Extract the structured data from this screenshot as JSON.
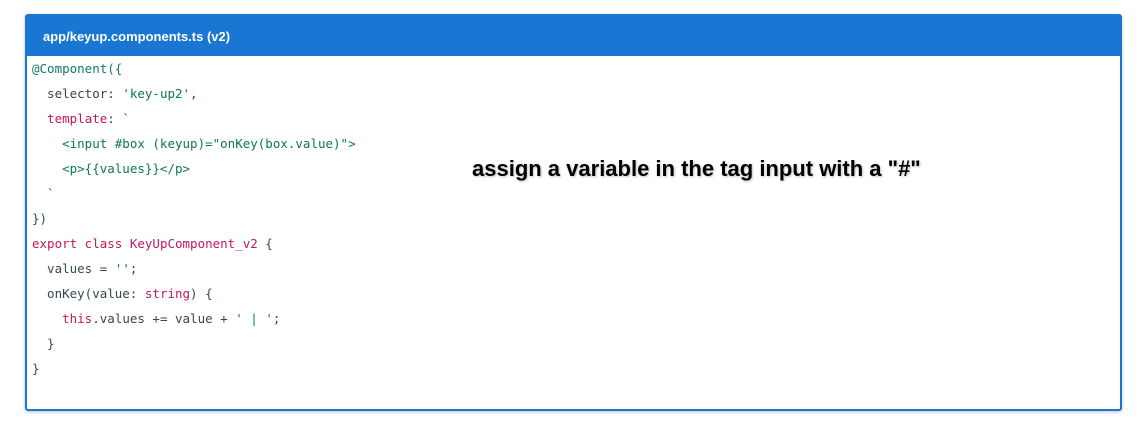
{
  "panel": {
    "title": "app/keyup.components.ts (v2)"
  },
  "code": {
    "lines": [
      [
        {
          "t": "@Component({",
          "c": "dec"
        }
      ],
      [
        {
          "t": "  selector: ",
          "c": "prop"
        },
        {
          "t": "'key-up2'",
          "c": "str"
        },
        {
          "t": ",",
          "c": "punc"
        }
      ],
      [
        {
          "t": "  ",
          "c": "punc"
        },
        {
          "t": "template",
          "c": "key"
        },
        {
          "t": ": `",
          "c": "punc"
        }
      ],
      [
        {
          "t": "    <input #box (keyup)=\"onKey(box.value)\">",
          "c": "tmpl"
        }
      ],
      [
        {
          "t": "    <p>{{values}}</p>",
          "c": "tmpl"
        }
      ],
      [
        {
          "t": "  `",
          "c": "punc"
        }
      ],
      [
        {
          "t": "})",
          "c": "punc"
        }
      ],
      [
        {
          "t": "export class ",
          "c": "kw"
        },
        {
          "t": "KeyUpComponent_v2",
          "c": "cls"
        },
        {
          "t": " {",
          "c": "punc"
        }
      ],
      [
        {
          "t": "  values = ",
          "c": "prop"
        },
        {
          "t": "''",
          "c": "str"
        },
        {
          "t": ";",
          "c": "punc"
        }
      ],
      [
        {
          "t": "  onKey(value: ",
          "c": "prop"
        },
        {
          "t": "string",
          "c": "kw"
        },
        {
          "t": ") {",
          "c": "punc"
        }
      ],
      [
        {
          "t": "    ",
          "c": "punc"
        },
        {
          "t": "this",
          "c": "kw"
        },
        {
          "t": ".values += value + ",
          "c": "prop"
        },
        {
          "t": "' | '",
          "c": "str"
        },
        {
          "t": ";",
          "c": "punc"
        }
      ],
      [
        {
          "t": "  }",
          "c": "punc"
        }
      ],
      [
        {
          "t": "}",
          "c": "punc"
        }
      ]
    ]
  },
  "annotation": {
    "text": "assign a variable in the tag input with a \"#\""
  },
  "colors": {
    "header_bg": "#1976d2",
    "keyword": "#c2185b",
    "string": "#0b7a4e"
  }
}
